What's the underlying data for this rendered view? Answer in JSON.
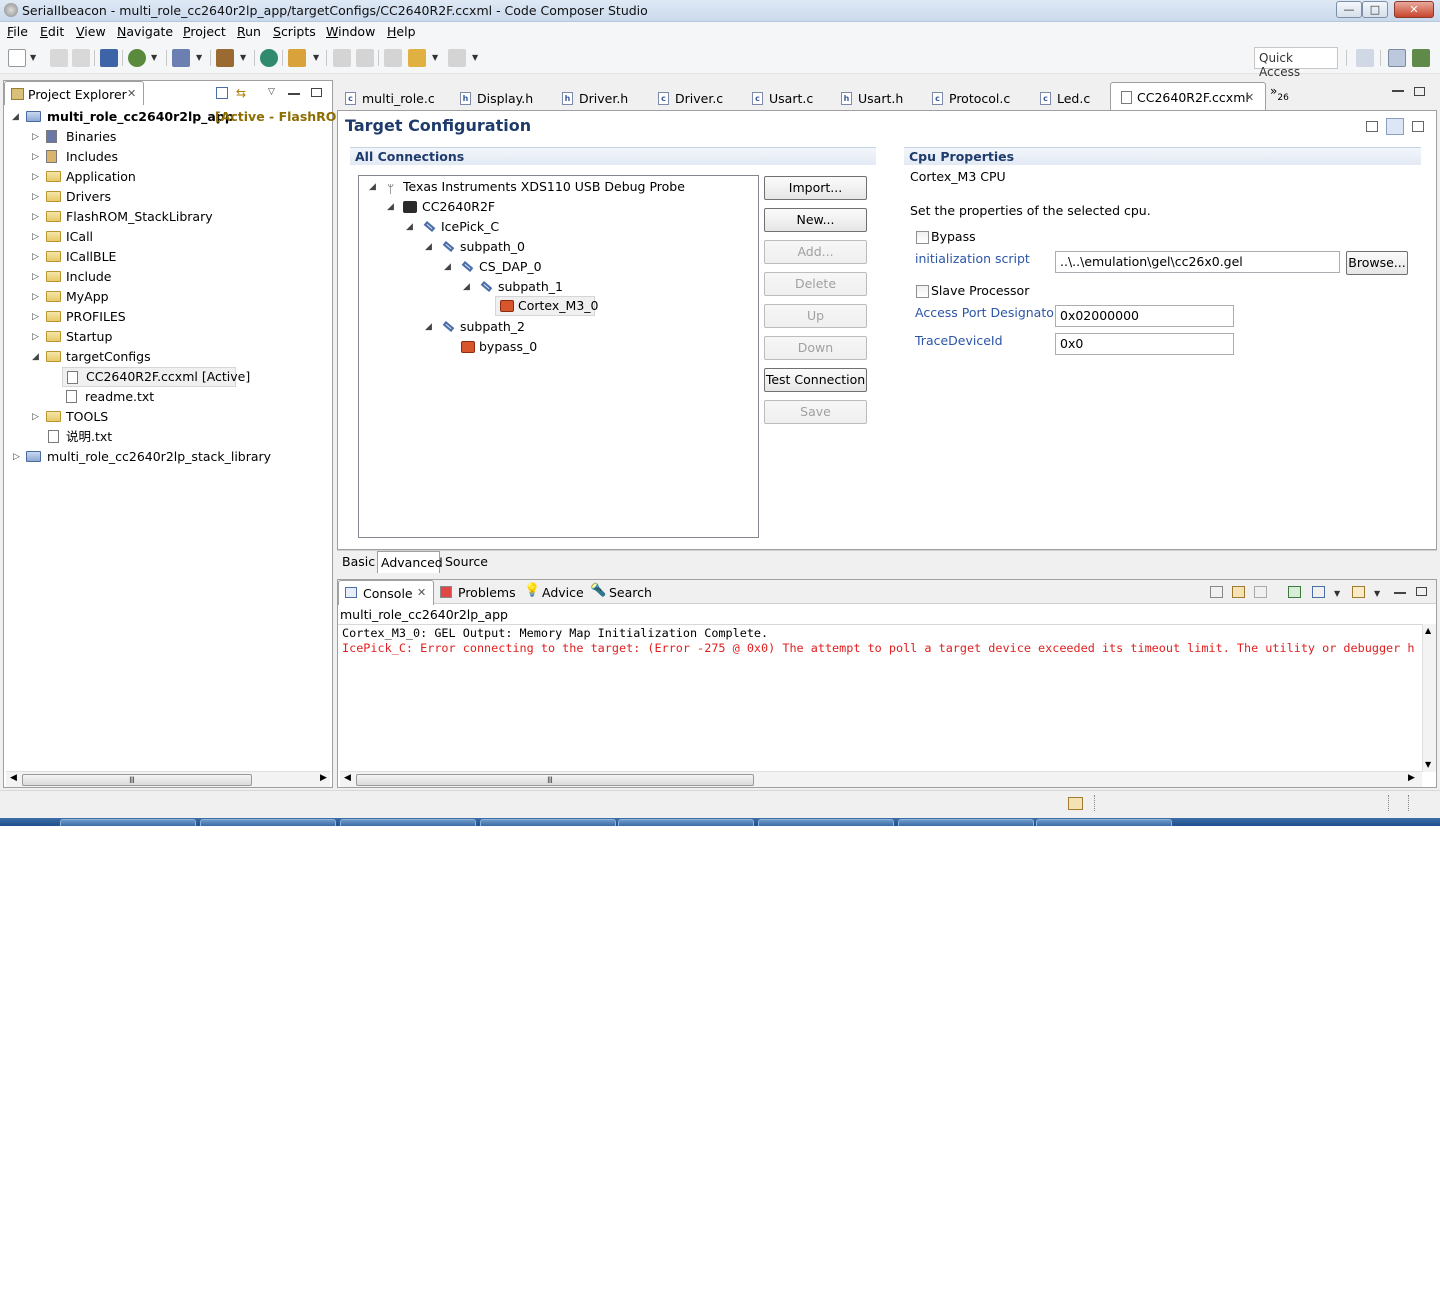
{
  "window": {
    "title": "SerialIbeacon - multi_role_cc2640r2lp_app/targetConfigs/CC2640R2F.ccxml - Code Composer Studio",
    "min": "—",
    "max": "□",
    "close": "✕"
  },
  "menu": [
    "File",
    "Edit",
    "View",
    "Navigate",
    "Project",
    "Run",
    "Scripts",
    "Window",
    "Help"
  ],
  "toolbar": {
    "quick_access": "Quick Access"
  },
  "project_explorer": {
    "tab_label": "Project Explorer",
    "root": {
      "name": "multi_role_cc2640r2lp_app",
      "status": "[Active - FlashROM"
    },
    "items": [
      {
        "label": "Binaries"
      },
      {
        "label": "Includes"
      },
      {
        "label": "Application"
      },
      {
        "label": "Drivers"
      },
      {
        "label": "FlashROM_StackLibrary"
      },
      {
        "label": "ICall"
      },
      {
        "label": "ICallBLE"
      },
      {
        "label": "Include"
      },
      {
        "label": "MyApp"
      },
      {
        "label": "PROFILES"
      },
      {
        "label": "Startup"
      },
      {
        "label": "targetConfigs"
      },
      {
        "label": "CC2640R2F.ccxml [Active]"
      },
      {
        "label": "readme.txt"
      },
      {
        "label": "TOOLS"
      },
      {
        "label": "说明.txt"
      },
      {
        "label": "multi_role_cc2640r2lp_stack_library"
      }
    ]
  },
  "editor_tabs": [
    "multi_role.c",
    "Display.h",
    "Driver.h",
    "Driver.c",
    "Usart.c",
    "Usart.h",
    "Protocol.c",
    "Led.c",
    "CC2640R2F.ccxml"
  ],
  "editor_overflow": "»",
  "editor_overflow_count": "26",
  "target_config": {
    "title": "Target Configuration",
    "all_connections": "All Connections",
    "tree": [
      "Texas Instruments XDS110 USB Debug Probe",
      "CC2640R2F",
      "IcePick_C",
      "subpath_0",
      "CS_DAP_0",
      "subpath_1",
      "Cortex_M3_0",
      "subpath_2",
      "bypass_0"
    ],
    "buttons": [
      {
        "label": "Import...",
        "enabled": true
      },
      {
        "label": "New...",
        "enabled": true
      },
      {
        "label": "Add...",
        "enabled": false
      },
      {
        "label": "Delete",
        "enabled": false
      },
      {
        "label": "Up",
        "enabled": false
      },
      {
        "label": "Down",
        "enabled": false
      },
      {
        "label": "Test Connection",
        "enabled": true
      },
      {
        "label": "Save",
        "enabled": false
      }
    ],
    "cpu": {
      "header": "Cpu Properties",
      "name": "Cortex_M3 CPU",
      "description": "Set the properties of the selected cpu.",
      "bypass": "Bypass",
      "init_script_label": "initialization script",
      "init_script_value": "..\\..\\emulation\\gel\\cc26x0.gel",
      "browse": "Browse...",
      "slave": "Slave Processor",
      "access_port_label": "Access Port Designator",
      "access_port_value": "0x02000000",
      "trace_label": "TraceDeviceId",
      "trace_value": "0x0"
    },
    "bottom_tabs": [
      "Basic",
      "Advanced",
      "Source"
    ]
  },
  "console": {
    "tabs": [
      "Console",
      "Problems",
      "Advice",
      "Search"
    ],
    "project": "multi_role_cc2640r2lp_app",
    "line1": "Cortex_M3_0: GEL Output: Memory Map Initialization Complete.",
    "line2": "IcePick_C: Error connecting to the target: (Error -275 @ 0x0) The attempt to poll a target device exceeded its timeout limit. The utility or debugger has",
    "error_color": "#e02020"
  },
  "scroll_grip": "III"
}
